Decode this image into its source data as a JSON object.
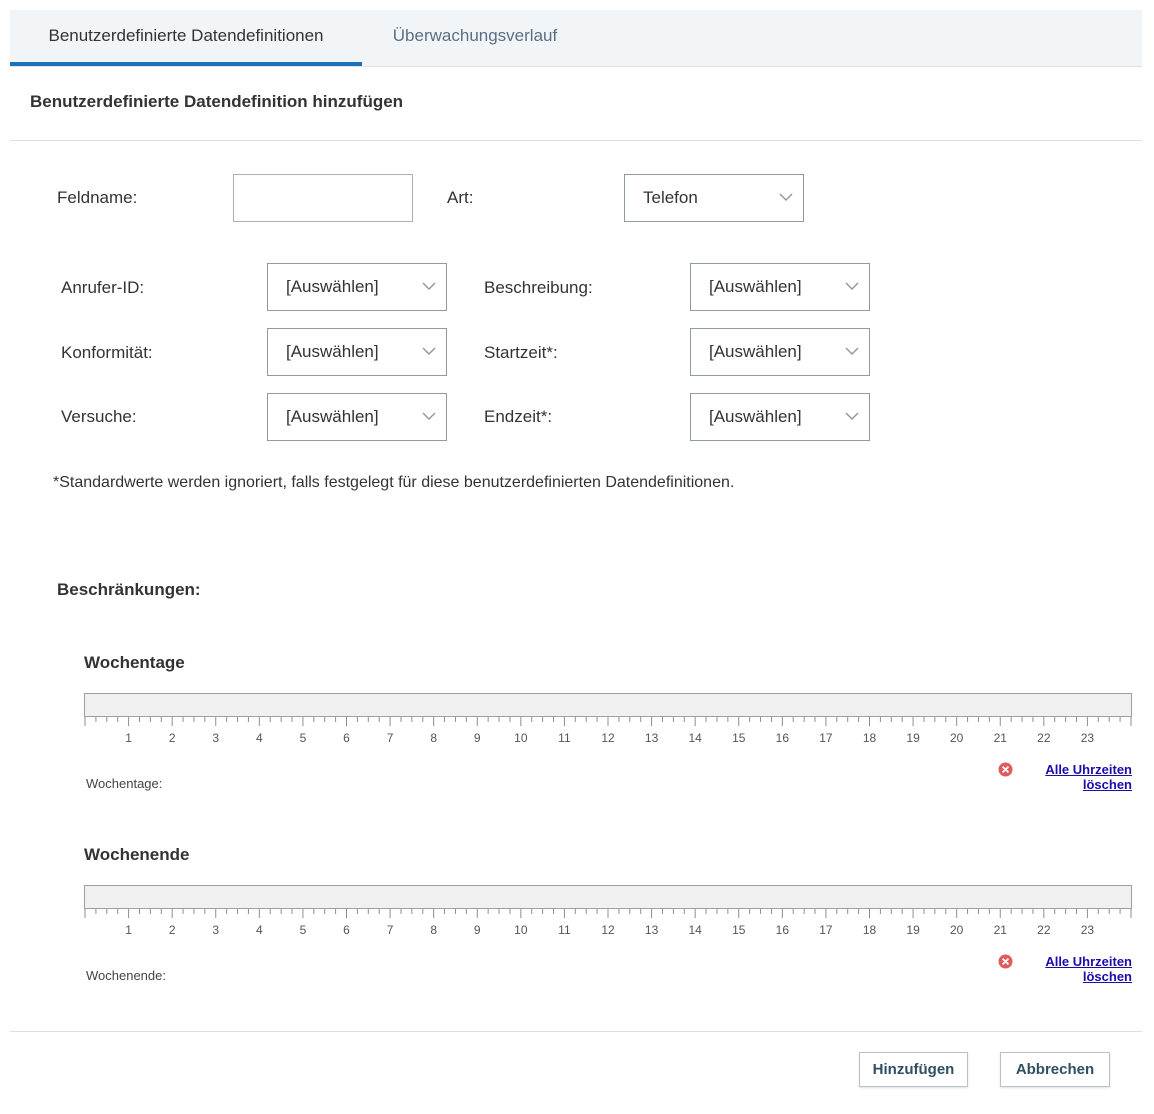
{
  "tabs": [
    {
      "label": "Benutzerdefinierte Datendefinitionen",
      "active": true
    },
    {
      "label": "Überwachungsverlauf",
      "active": false
    }
  ],
  "section_title": "Benutzerdefinierte Datendefinition hinzufügen",
  "form": {
    "fieldname_label": "Feldname:",
    "fieldname_value": "",
    "art_label": "Art:",
    "art_value": "Telefon",
    "anrufer_label": "Anrufer-ID:",
    "anrufer_value": "[Auswählen]",
    "beschreibung_label": "Beschreibung:",
    "beschreibung_value": "[Auswählen]",
    "konformitaet_label": "Konformität:",
    "konformitaet_value": "[Auswählen]",
    "startzeit_label": "Startzeit*:",
    "startzeit_value": "[Auswählen]",
    "versuche_label": "Versuche:",
    "versuche_value": "[Auswählen]",
    "endzeit_label": "Endzeit*:",
    "endzeit_value": "[Auswählen]"
  },
  "note": "*Standardwerte werden ignoriert, falls festgelegt für diese benutzerdefinierten Datendefinitionen.",
  "restrictions_label": "Beschränkungen:",
  "hour_ticks": [
    "1",
    "2",
    "3",
    "4",
    "5",
    "6",
    "7",
    "8",
    "9",
    "10",
    "11",
    "12",
    "13",
    "14",
    "15",
    "16",
    "17",
    "18",
    "19",
    "20",
    "21",
    "22",
    "23"
  ],
  "weekdays": {
    "title": "Wochentage",
    "label": "Wochentage:",
    "clear_link_line1": "Alle Uhrzeiten",
    "clear_link_line2": "löschen"
  },
  "weekend": {
    "title": "Wochenende",
    "label": "Wochenende:",
    "clear_link_line1": "Alle Uhrzeiten",
    "clear_link_line2": "löschen"
  },
  "buttons": {
    "add": "Hinzufügen",
    "cancel": "Abbrechen"
  },
  "colors": {
    "accent": "#1d6fb8",
    "link": "#1a0dab",
    "clear_icon": "#e05c5c"
  }
}
